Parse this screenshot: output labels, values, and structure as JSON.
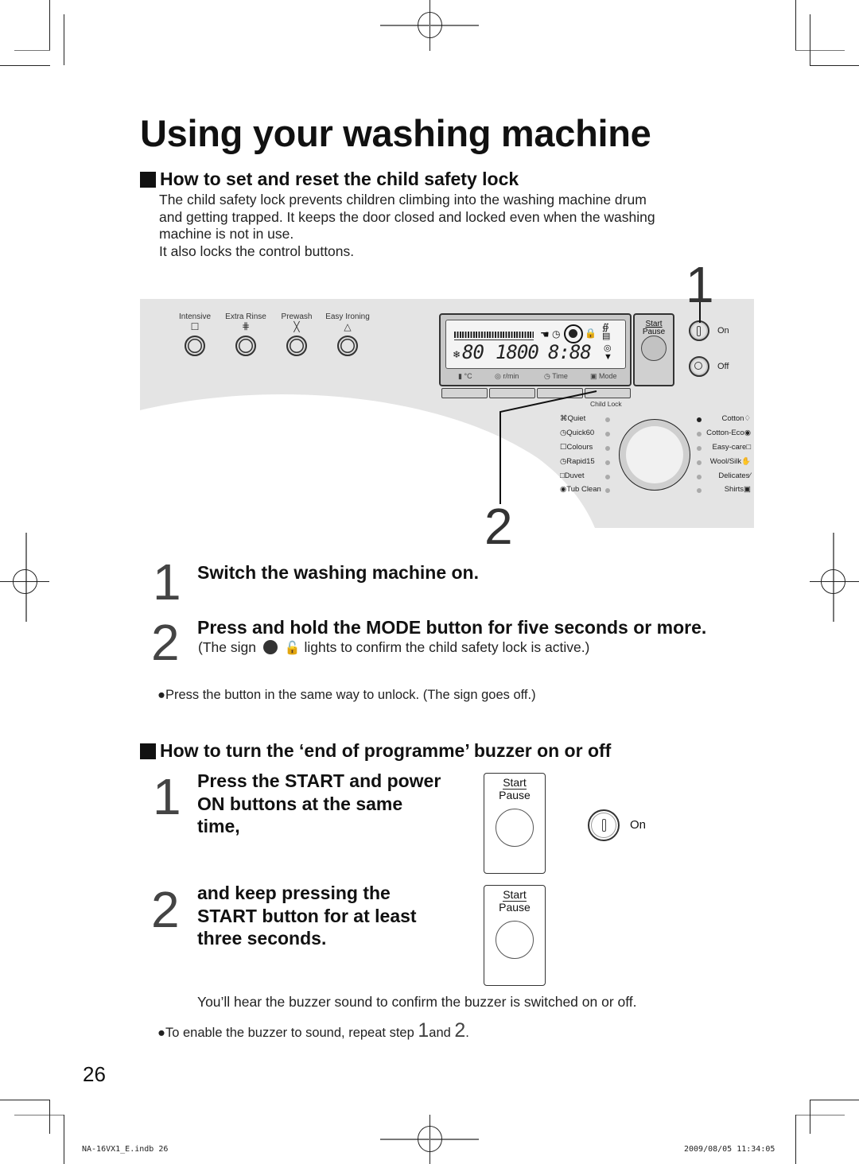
{
  "page": {
    "title": "Using your washing machine",
    "page_number": "26",
    "slug_file": "NA-16VX1_E.indb   26",
    "slug_date": "2009/08/05   11:34:05"
  },
  "child_lock_section": {
    "heading": "How to set and reset the child safety lock",
    "intro_lines": [
      "The child safety lock prevents children climbing into the washing machine drum",
      "and getting trapped. It keeps the door closed and locked even when the washing",
      "machine is not in use.",
      "It also locks the control buttons."
    ],
    "steps": [
      {
        "number": "1",
        "text": "Switch the washing machine on."
      },
      {
        "number": "2",
        "text": "Press and hold the MODE button for five seconds or more.",
        "note_before": "(The sign",
        "note_after": "lights to confirm the child safety lock is active.)"
      }
    ],
    "bullet": "●Press the button in the same way to unlock. (The sign goes off.)"
  },
  "control_panel": {
    "callout_1": "1",
    "callout_2": "2",
    "option_buttons": [
      {
        "label": "Intensive",
        "icon": "shirt-icon",
        "glyph": "👕"
      },
      {
        "label": "Extra Rinse",
        "icon": "rinse-plus-icon",
        "glyph": "+"
      },
      {
        "label": "Prewash",
        "icon": "prewash-tub-icon",
        "glyph": "┴"
      },
      {
        "label": "Easy Ironing",
        "icon": "iron-icon",
        "glyph": "⏢"
      }
    ],
    "lcd": {
      "temp_digits": "80",
      "spin_digits": "1800",
      "time_digits": "8:88",
      "labels": [
        "°C",
        "r/min",
        "Time",
        "Mode"
      ],
      "status_icons": [
        "shirt-icon",
        "clock-icon",
        "child-face-icon",
        "padlock-icon"
      ]
    },
    "start_pause": {
      "line1": "Start",
      "line2": "Pause"
    },
    "power": {
      "on_label": "On",
      "off_label": "Off"
    },
    "child_lock_label": "Child Lock",
    "programmes_left": [
      "Quiet",
      "Quick60",
      "Colours",
      "Rapid15",
      "Duvet",
      "Tub Clean"
    ],
    "programmes_right": [
      "Cotton",
      "Cotton-Eco",
      "Easy-care",
      "Wool/Silk",
      "Delicates",
      "Shirts"
    ],
    "selected_programme": "Cotton"
  },
  "buzzer_section": {
    "heading": "How to turn the ‘end of programme’ buzzer on or off",
    "steps": [
      {
        "number": "1",
        "lines": [
          "Press the START and power",
          "ON buttons at the same",
          "time,"
        ]
      },
      {
        "number": "2",
        "lines": [
          "and keep pressing the",
          "START button for at least",
          "three seconds."
        ]
      }
    ],
    "start_pause": {
      "line1": "Start",
      "line2": "Pause"
    },
    "on_label": "On",
    "confirm_text": "You’ll hear the buzzer sound to confirm the buzzer is switched on or off.",
    "bullet_prefix": "●To enable the buzzer to sound, repeat step ",
    "bullet_step1": "1",
    "bullet_mid": "and ",
    "bullet_step2": "2",
    "bullet_end": "."
  }
}
